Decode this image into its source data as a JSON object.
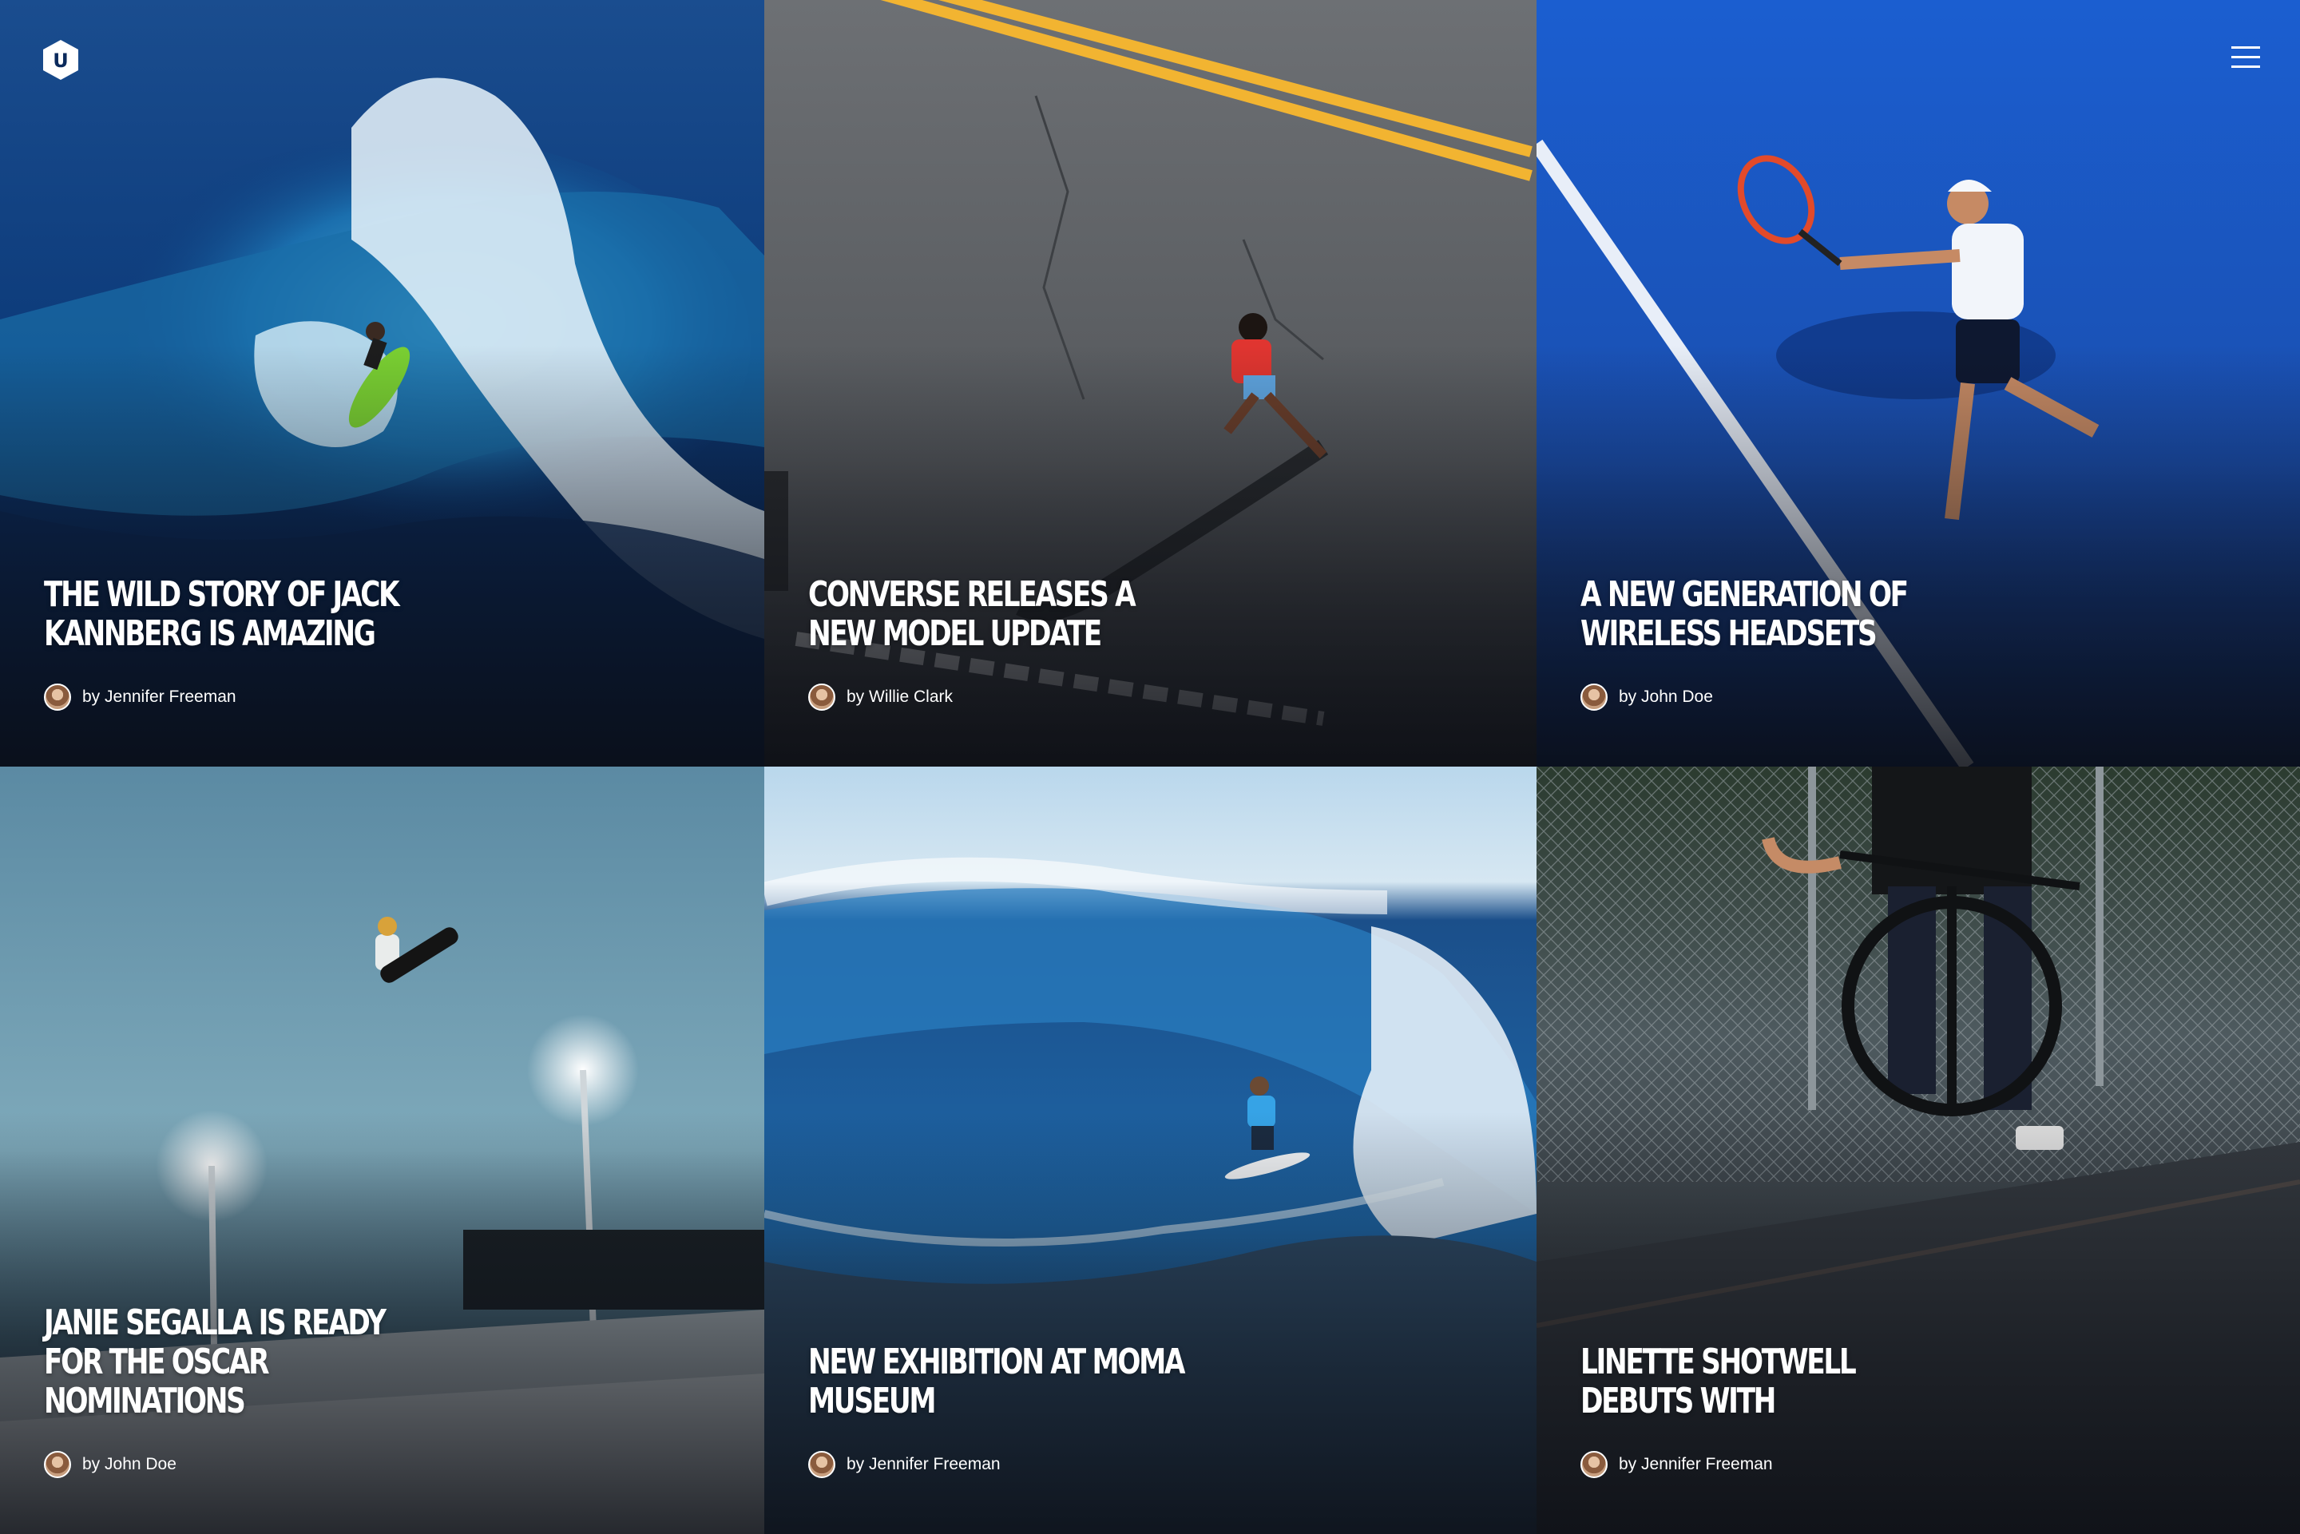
{
  "header": {
    "logo_letter": "U",
    "menu_icon": "hamburger-menu-icon"
  },
  "articles": [
    {
      "title": "THE WILD STORY OF JACK KANNBERG IS AMAZING",
      "author": "by Jennifer Freeman",
      "photo": "surfer-wave-photo"
    },
    {
      "title": "CONVERSE RELEASES A NEW MODEL UPDATE",
      "author": "by Willie Clark",
      "photo": "runner-road-photo"
    },
    {
      "title": "A NEW GENERATION OF WIRELESS HEADSETS",
      "author": "by John Doe",
      "photo": "tennis-player-photo"
    },
    {
      "title": "JANIE SEGALLA IS READY FOR THE OSCAR NOMINATIONS",
      "author": "by John Doe",
      "photo": "snowboarder-jump-photo"
    },
    {
      "title": "NEW EXHIBITION AT MOMA MUSEUM",
      "author": "by Jennifer Freeman",
      "photo": "surfer-barrel-photo"
    },
    {
      "title": "LINETTE SHOTWELL DEBUTS WITH",
      "author": "by Jennifer Freeman",
      "photo": "bmx-rider-photo"
    }
  ],
  "colors": {
    "ocean_dark": "#0b2a5c",
    "road_gray": "#5d6064",
    "court_blue": "#1a56c9",
    "sky_teal": "#6f9bb0",
    "wave_blue": "#1f5f9e",
    "street_dark": "#2b3036",
    "road_line_yellow": "#f2b431"
  }
}
